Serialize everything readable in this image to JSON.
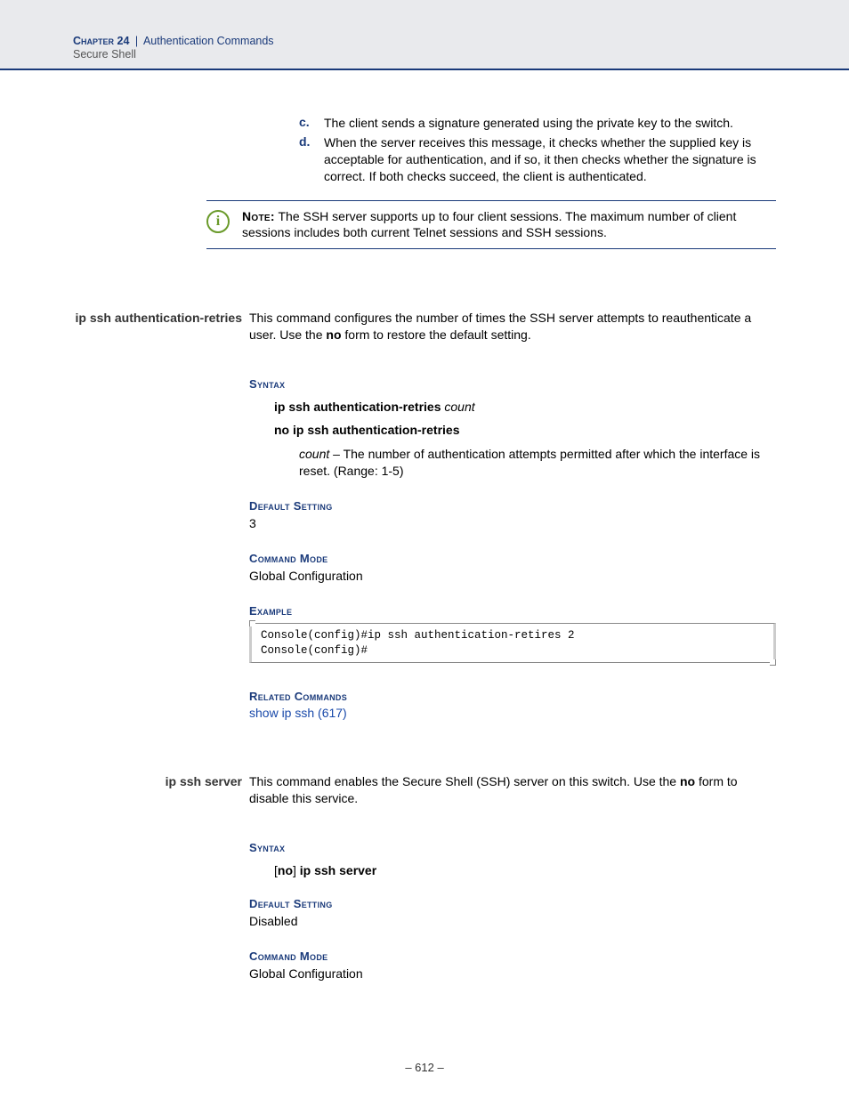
{
  "header": {
    "chapter_label": "Chapter 24",
    "pipe": "|",
    "chapter_title": "Authentication Commands",
    "subtitle": "Secure Shell"
  },
  "intro_list": {
    "c_marker": "c.",
    "c_text": "The client sends a signature generated using the private key to the switch.",
    "d_marker": "d.",
    "d_text": "When the server receives this message, it checks whether the supplied key is acceptable for authentication, and if so, it then checks whether the signature is correct. If both checks succeed, the client is authenticated."
  },
  "note": {
    "label": "Note:",
    "text": " The SSH server supports up to four client sessions. The maximum number of client sessions includes both current Telnet sessions and SSH sessions."
  },
  "cmd1": {
    "name": "ip ssh authentication-retries",
    "desc_pre": "This command configures the number of times the SSH server attempts to reauthenticate a user. Use the ",
    "desc_bold": "no",
    "desc_post": " form to restore the default setting.",
    "syntax_heading": "Syntax",
    "syntax_line1_bold": "ip ssh authentication-retries ",
    "syntax_line1_italic": "count",
    "syntax_line2": "no ip ssh authentication-retries",
    "param_name": "count",
    "param_desc": " – The number of authentication attempts permitted after which the interface is reset. (Range: 1-5)",
    "default_heading": "Default Setting",
    "default_value": "3",
    "mode_heading": "Command Mode",
    "mode_value": "Global Configuration",
    "example_heading": "Example",
    "example_code": "Console(config)#ip ssh authentication-retires 2\nConsole(config)#",
    "related_heading": "Related Commands",
    "related_link": "show ip ssh (617)"
  },
  "cmd2": {
    "name": "ip ssh server",
    "desc_pre": "This command enables the Secure Shell (SSH) server on this switch. Use the ",
    "desc_bold": "no",
    "desc_post": " form to disable this service.",
    "syntax_heading": "Syntax",
    "syntax_lb": "[",
    "syntax_no": "no",
    "syntax_rb": "] ",
    "syntax_cmd": "ip ssh server",
    "default_heading": "Default Setting",
    "default_value": "Disabled",
    "mode_heading": "Command Mode",
    "mode_value": "Global Configuration"
  },
  "footer": {
    "page": "–  612  –"
  }
}
